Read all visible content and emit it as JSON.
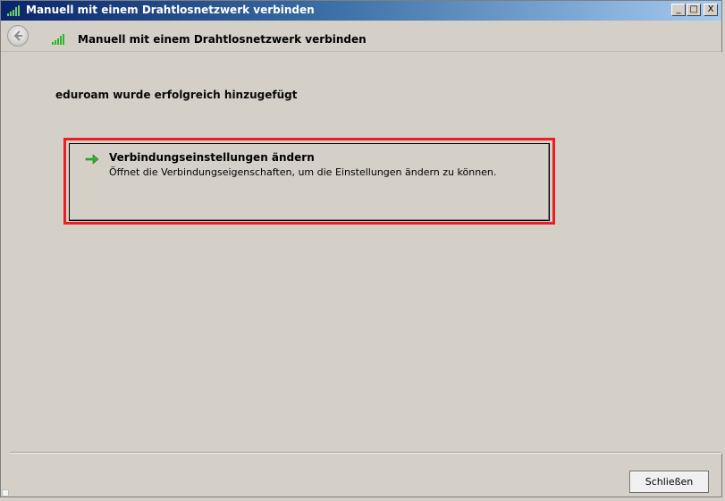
{
  "window": {
    "title": "Manuell mit einem Drahtlosnetzwerk verbinden",
    "minimize_glyph": "_",
    "maximize_glyph": "□",
    "close_glyph": "X"
  },
  "nav": {
    "title": "Manuell mit einem Drahtlosnetzwerk verbinden",
    "back_icon": "back-arrow-icon",
    "network_icon": "wireless-signal-icon"
  },
  "main": {
    "heading": "eduroam wurde erfolgreich hinzugefügt",
    "option": {
      "title": "Verbindungseinstellungen ändern",
      "description": "Öffnet die Verbindungseigenschaften, um die Einstellungen ändern zu können.",
      "icon": "green-arrow-icon"
    }
  },
  "footer": {
    "close_label": "Schließen"
  },
  "colors": {
    "highlight": "#ee1c25",
    "titlebar_start": "#0a246a",
    "titlebar_end": "#a6caf0",
    "arrow_green": "#2db52d"
  }
}
